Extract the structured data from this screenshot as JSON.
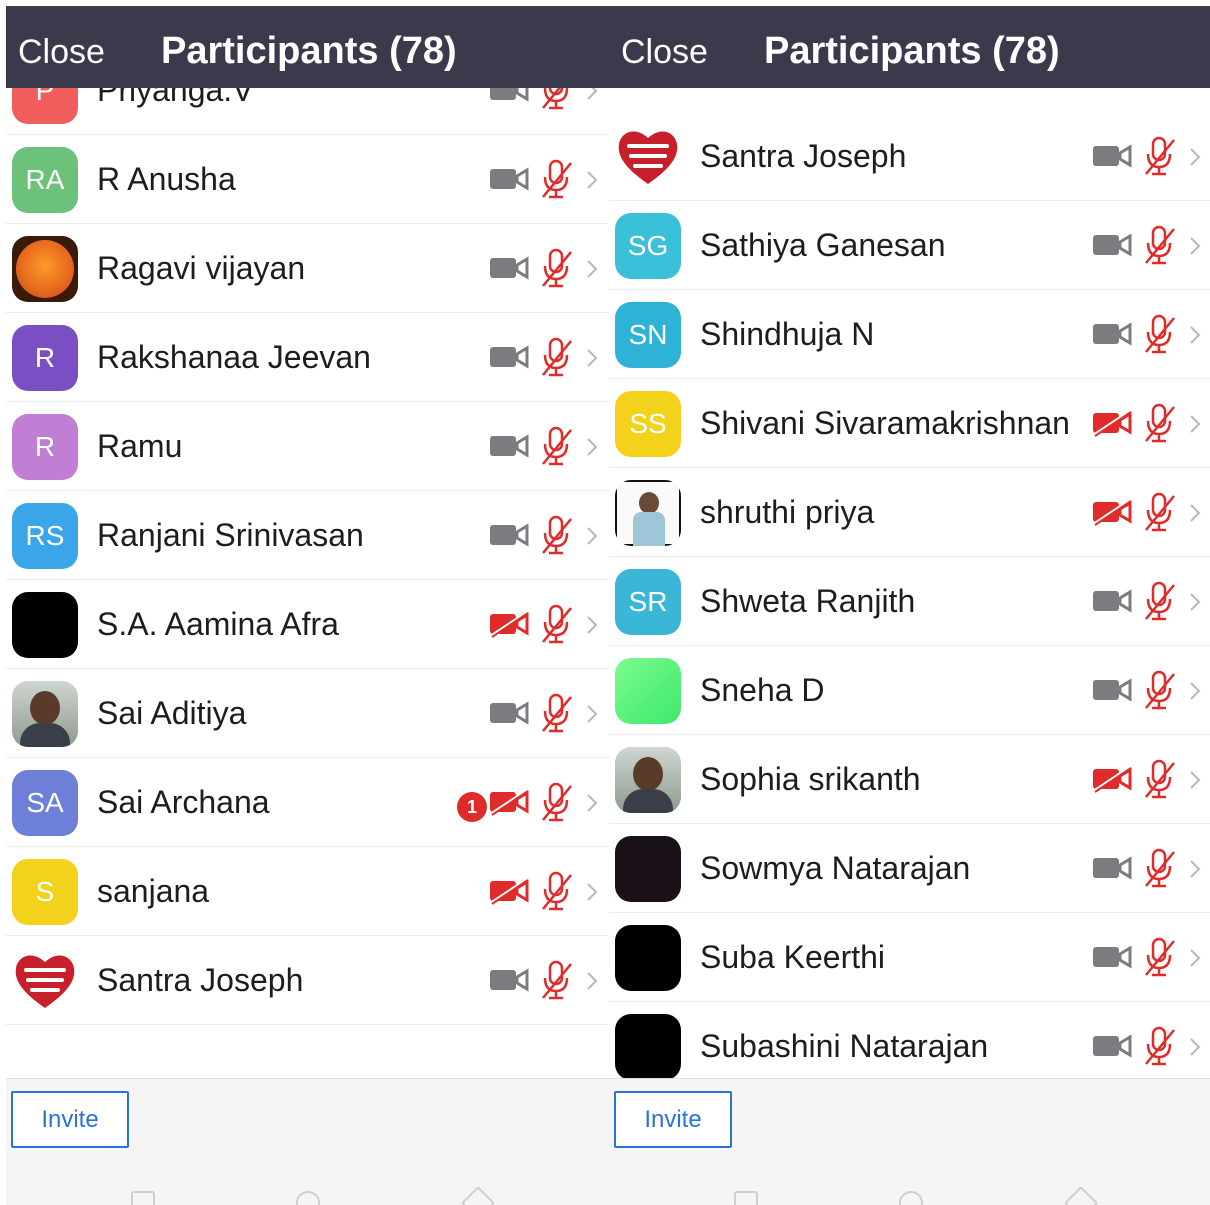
{
  "colors": {
    "header_bg": "#3a3a4c",
    "accent_blue": "#2a73d8",
    "muted_red": "#e02b2b",
    "icon_gray": "#7c7c80"
  },
  "panels": [
    {
      "header": {
        "close_label": "Close",
        "title": "Participants (78)"
      },
      "invite_label": "Invite",
      "participants": [
        {
          "name": "Priyanga.V",
          "initials": "P",
          "avatar_color": "#f25d5d",
          "avatar_kind": "initials",
          "video_off": false,
          "muted": true
        },
        {
          "name": "R Anusha",
          "initials": "RA",
          "avatar_color": "#6cc27a",
          "avatar_kind": "initials",
          "video_off": false,
          "muted": true
        },
        {
          "name": "Ragavi vijayan",
          "initials": "",
          "avatar_color": "#e0761b",
          "avatar_kind": "photo-orange",
          "video_off": false,
          "muted": true
        },
        {
          "name": "Rakshanaa Jeevan",
          "initials": "R",
          "avatar_color": "#7b4fc4",
          "avatar_kind": "initials",
          "video_off": false,
          "muted": true
        },
        {
          "name": "Ramu",
          "initials": "R",
          "avatar_color": "#c07fd4",
          "avatar_kind": "initials",
          "video_off": false,
          "muted": true
        },
        {
          "name": "Ranjani Srinivasan",
          "initials": "RS",
          "avatar_color": "#3aa5e8",
          "avatar_kind": "initials",
          "video_off": false,
          "muted": true
        },
        {
          "name": "S.A. Aamina Afra",
          "initials": "",
          "avatar_color": "#000000",
          "avatar_kind": "photo-black",
          "video_off": true,
          "muted": true
        },
        {
          "name": "Sai Aditiya",
          "initials": "",
          "avatar_color": "#5a4a3a",
          "avatar_kind": "photo-person",
          "video_off": false,
          "muted": true
        },
        {
          "name": "Sai Archana",
          "initials": "SA",
          "avatar_color": "#6d7fd6",
          "avatar_kind": "initials",
          "video_off": true,
          "muted": true,
          "badge": "1"
        },
        {
          "name": "sanjana",
          "initials": "S",
          "avatar_color": "#f2d21a",
          "avatar_kind": "initials",
          "video_off": true,
          "muted": true
        },
        {
          "name": "Santra Joseph",
          "initials": "",
          "avatar_color": "#c8202a",
          "avatar_kind": "heart",
          "video_off": false,
          "muted": true
        }
      ]
    },
    {
      "header": {
        "close_label": "Close",
        "title": "Participants (78)"
      },
      "invite_label": "Invite",
      "participants": [
        {
          "name": "Santra Joseph",
          "initials": "",
          "avatar_color": "#c8202a",
          "avatar_kind": "heart",
          "video_off": false,
          "muted": true
        },
        {
          "name": "Sathiya Ganesan",
          "initials": "SG",
          "avatar_color": "#3ac0d8",
          "avatar_kind": "initials",
          "video_off": false,
          "muted": true
        },
        {
          "name": "Shindhuja N",
          "initials": "SN",
          "avatar_color": "#2eb3d6",
          "avatar_kind": "initials",
          "video_off": false,
          "muted": true
        },
        {
          "name": "Shivani Sivaramakrishnan",
          "initials": "SS",
          "avatar_color": "#f2d21a",
          "avatar_kind": "initials",
          "video_off": true,
          "muted": true
        },
        {
          "name": "shruthi priya",
          "initials": "",
          "avatar_color": "#d8d8d8",
          "avatar_kind": "photo-person-light",
          "video_off": true,
          "muted": true
        },
        {
          "name": "Shweta Ranjith",
          "initials": "SR",
          "avatar_color": "#3ab7d6",
          "avatar_kind": "initials",
          "video_off": false,
          "muted": true
        },
        {
          "name": "Sneha D",
          "initials": "",
          "avatar_color": "#5cf07a",
          "avatar_kind": "photo-green",
          "video_off": false,
          "muted": true
        },
        {
          "name": "Sophia srikanth",
          "initials": "",
          "avatar_color": "#8a6a55",
          "avatar_kind": "photo-person",
          "video_off": true,
          "muted": true
        },
        {
          "name": "Sowmya Natarajan",
          "initials": "",
          "avatar_color": "#1a1018",
          "avatar_kind": "photo-black",
          "video_off": false,
          "muted": true
        },
        {
          "name": "Suba Keerthi",
          "initials": "",
          "avatar_color": "#000000",
          "avatar_kind": "photo-black",
          "video_off": false,
          "muted": true
        },
        {
          "name": "Subashini Natarajan",
          "initials": "",
          "avatar_color": "#000000",
          "avatar_kind": "photo-black",
          "video_off": false,
          "muted": true
        }
      ]
    }
  ]
}
